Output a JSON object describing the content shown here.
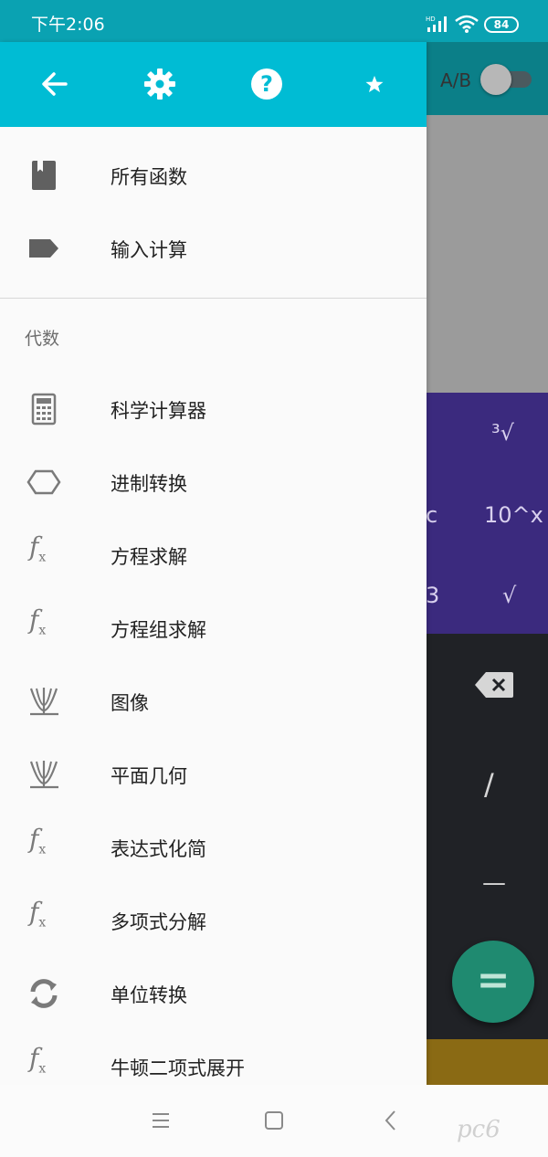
{
  "status_bar": {
    "time": "下午2:06",
    "network": "HD",
    "battery": "84"
  },
  "background_app": {
    "ab_label": "A/B",
    "ab_toggle_on": false,
    "purple_keys": [
      "³√",
      "c",
      "10^x",
      "3",
      "√"
    ],
    "dark_keys": [
      "/",
      "—"
    ],
    "equals_label": "="
  },
  "drawer": {
    "header_icons": [
      "back-arrow-icon",
      "gear-icon",
      "help-icon",
      "star-icon"
    ],
    "top_items": [
      {
        "label": "所有函数",
        "icon": "book-icon"
      },
      {
        "label": "输入计算",
        "icon": "label-tag-icon"
      }
    ],
    "section_title": "代数",
    "items": [
      {
        "label": "科学计算器",
        "icon": "calculator-icon"
      },
      {
        "label": "进制转换",
        "icon": "hexagon-icon"
      },
      {
        "label": "方程求解",
        "icon": "fx-icon"
      },
      {
        "label": "方程组求解",
        "icon": "fx-icon"
      },
      {
        "label": "图像",
        "icon": "graph-icon"
      },
      {
        "label": "平面几何",
        "icon": "graph-icon"
      },
      {
        "label": "表达式化简",
        "icon": "fx-icon"
      },
      {
        "label": "多项式分解",
        "icon": "fx-icon"
      },
      {
        "label": "单位转换",
        "icon": "refresh-icon"
      },
      {
        "label": "牛顿二项式展开",
        "icon": "fx-icon"
      }
    ]
  },
  "nav_bar": {
    "buttons": [
      "menu-icon",
      "home-square-icon",
      "back-chevron-icon"
    ]
  },
  "watermark": "pc6"
}
